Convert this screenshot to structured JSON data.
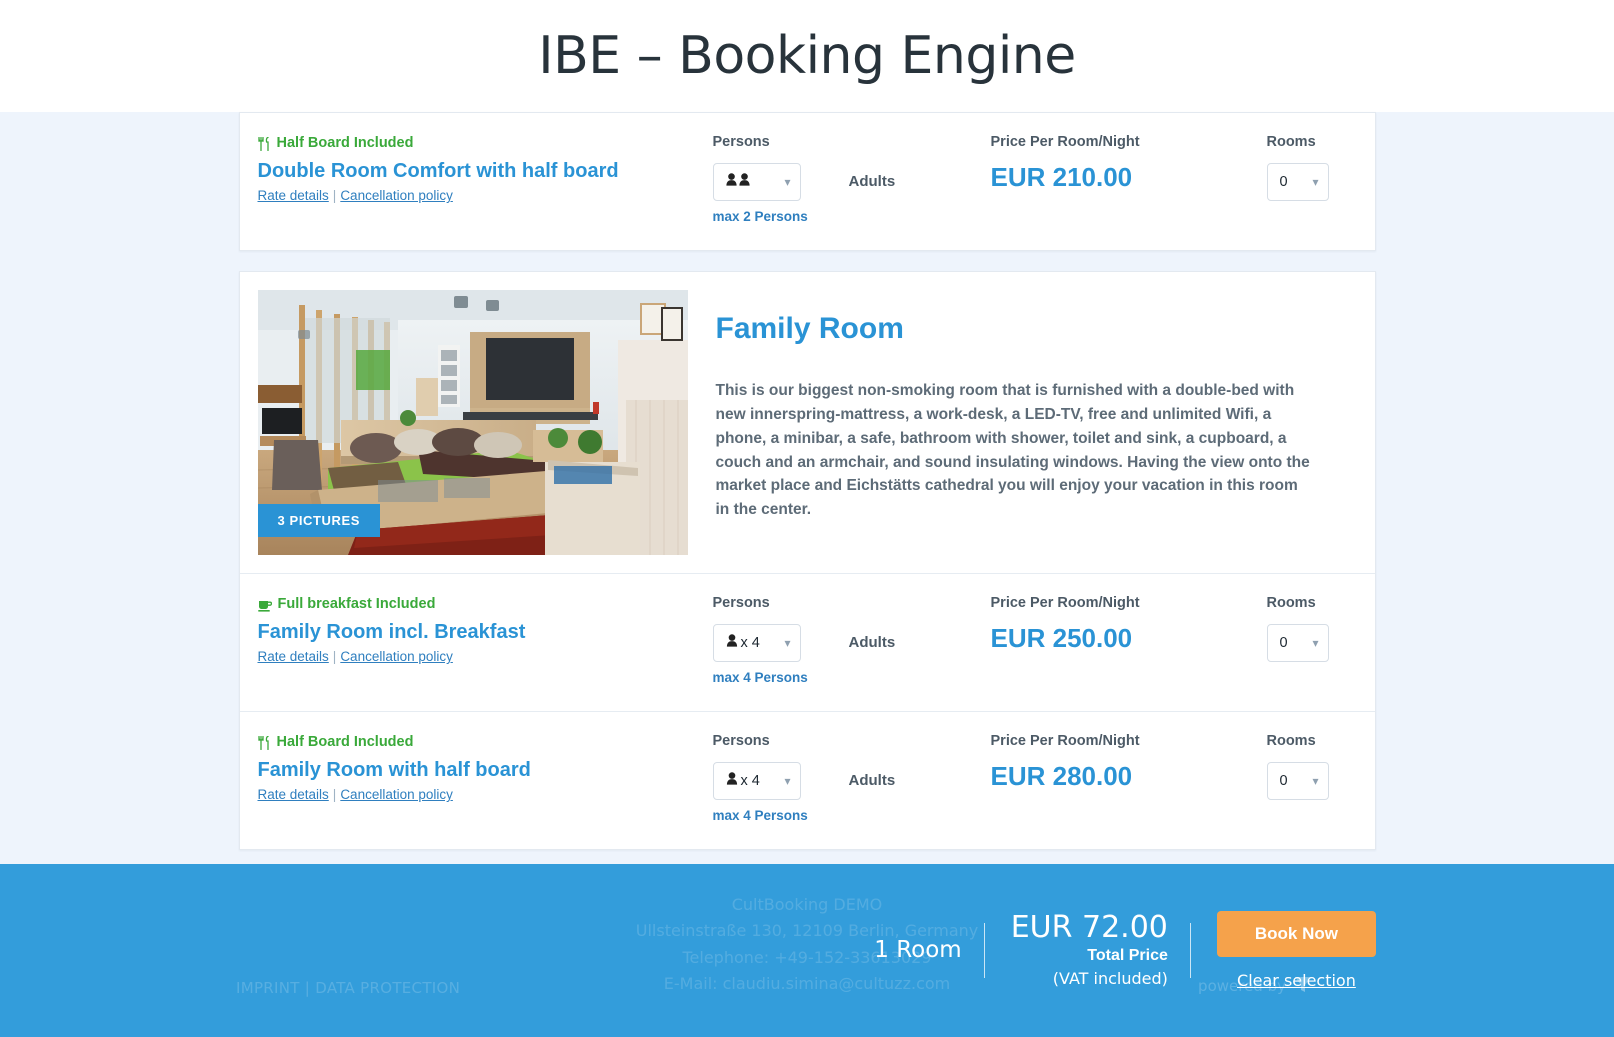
{
  "header": {
    "title": "IBE – Booking Engine"
  },
  "colors": {
    "accent_blue": "#2a93d5",
    "footer_blue": "#339ddb",
    "book_button_orange": "#f5a24b",
    "board_green": "#3aa93a",
    "page_background": "#eef4fc"
  },
  "column_headers": {
    "persons": "Persons",
    "price": "Price Per Room/Night",
    "rooms": "Rooms"
  },
  "labels": {
    "adults": "Adults",
    "rate_details": "Rate details",
    "cancellation_policy": "Cancellation policy",
    "separator": "|"
  },
  "rates": [
    {
      "board": "Half Board Included",
      "board_icon": "cutlery-icon",
      "name": "Double Room Comfort with half board",
      "persons_value": " ",
      "persons_icon": "two-persons-icon",
      "max_persons": "max 2 Persons",
      "price": "EUR 210.00",
      "rooms_value": "0"
    }
  ],
  "room": {
    "title": "Family Room",
    "description": "This is our biggest non-smoking room that is furnished with a double-bed with new innerspring-mattress, a work-desk, a LED-TV, free and unlimited Wifi, a phone, a minibar, a safe, bathroom with shower, toilet and sink, a cupboard, a couch and an armchair, and sound insulating windows. Having the view onto the market place and Eichstätts cathedral you will enjoy your vacation in this room in the center.",
    "pictures_badge": "3 PICTURES",
    "rates": [
      {
        "board": "Full breakfast Included",
        "board_icon": "coffee-cup-icon",
        "name": "Family Room incl. Breakfast",
        "persons_value": "x 4",
        "persons_icon": "person-icon",
        "max_persons": "max 4 Persons",
        "price": "EUR 250.00",
        "rooms_value": "0"
      },
      {
        "board": "Half Board Included",
        "board_icon": "cutlery-icon",
        "name": "Family Room with half board",
        "persons_value": "x 4",
        "persons_icon": "person-icon",
        "max_persons": "max 4 Persons",
        "price": "EUR 280.00",
        "rooms_value": "0"
      }
    ]
  },
  "footer": {
    "company": "CultBooking DEMO",
    "address": "Ullsteinstraße 130, 12109 Berlin, Germany",
    "telephone": "Telephone: +49-152-33613029",
    "email": "E-Mail: claudiu.simina@cultuzz.com",
    "imprint": "IMPRINT | DATA PROTECTION",
    "powered_by": "powered by",
    "rooms_count": "1 Room",
    "total_amount": "EUR 72.00",
    "total_label": "Total Price",
    "total_vat": "(VAT included)",
    "book_button": "Book Now",
    "clear_selection": "Clear selection"
  }
}
